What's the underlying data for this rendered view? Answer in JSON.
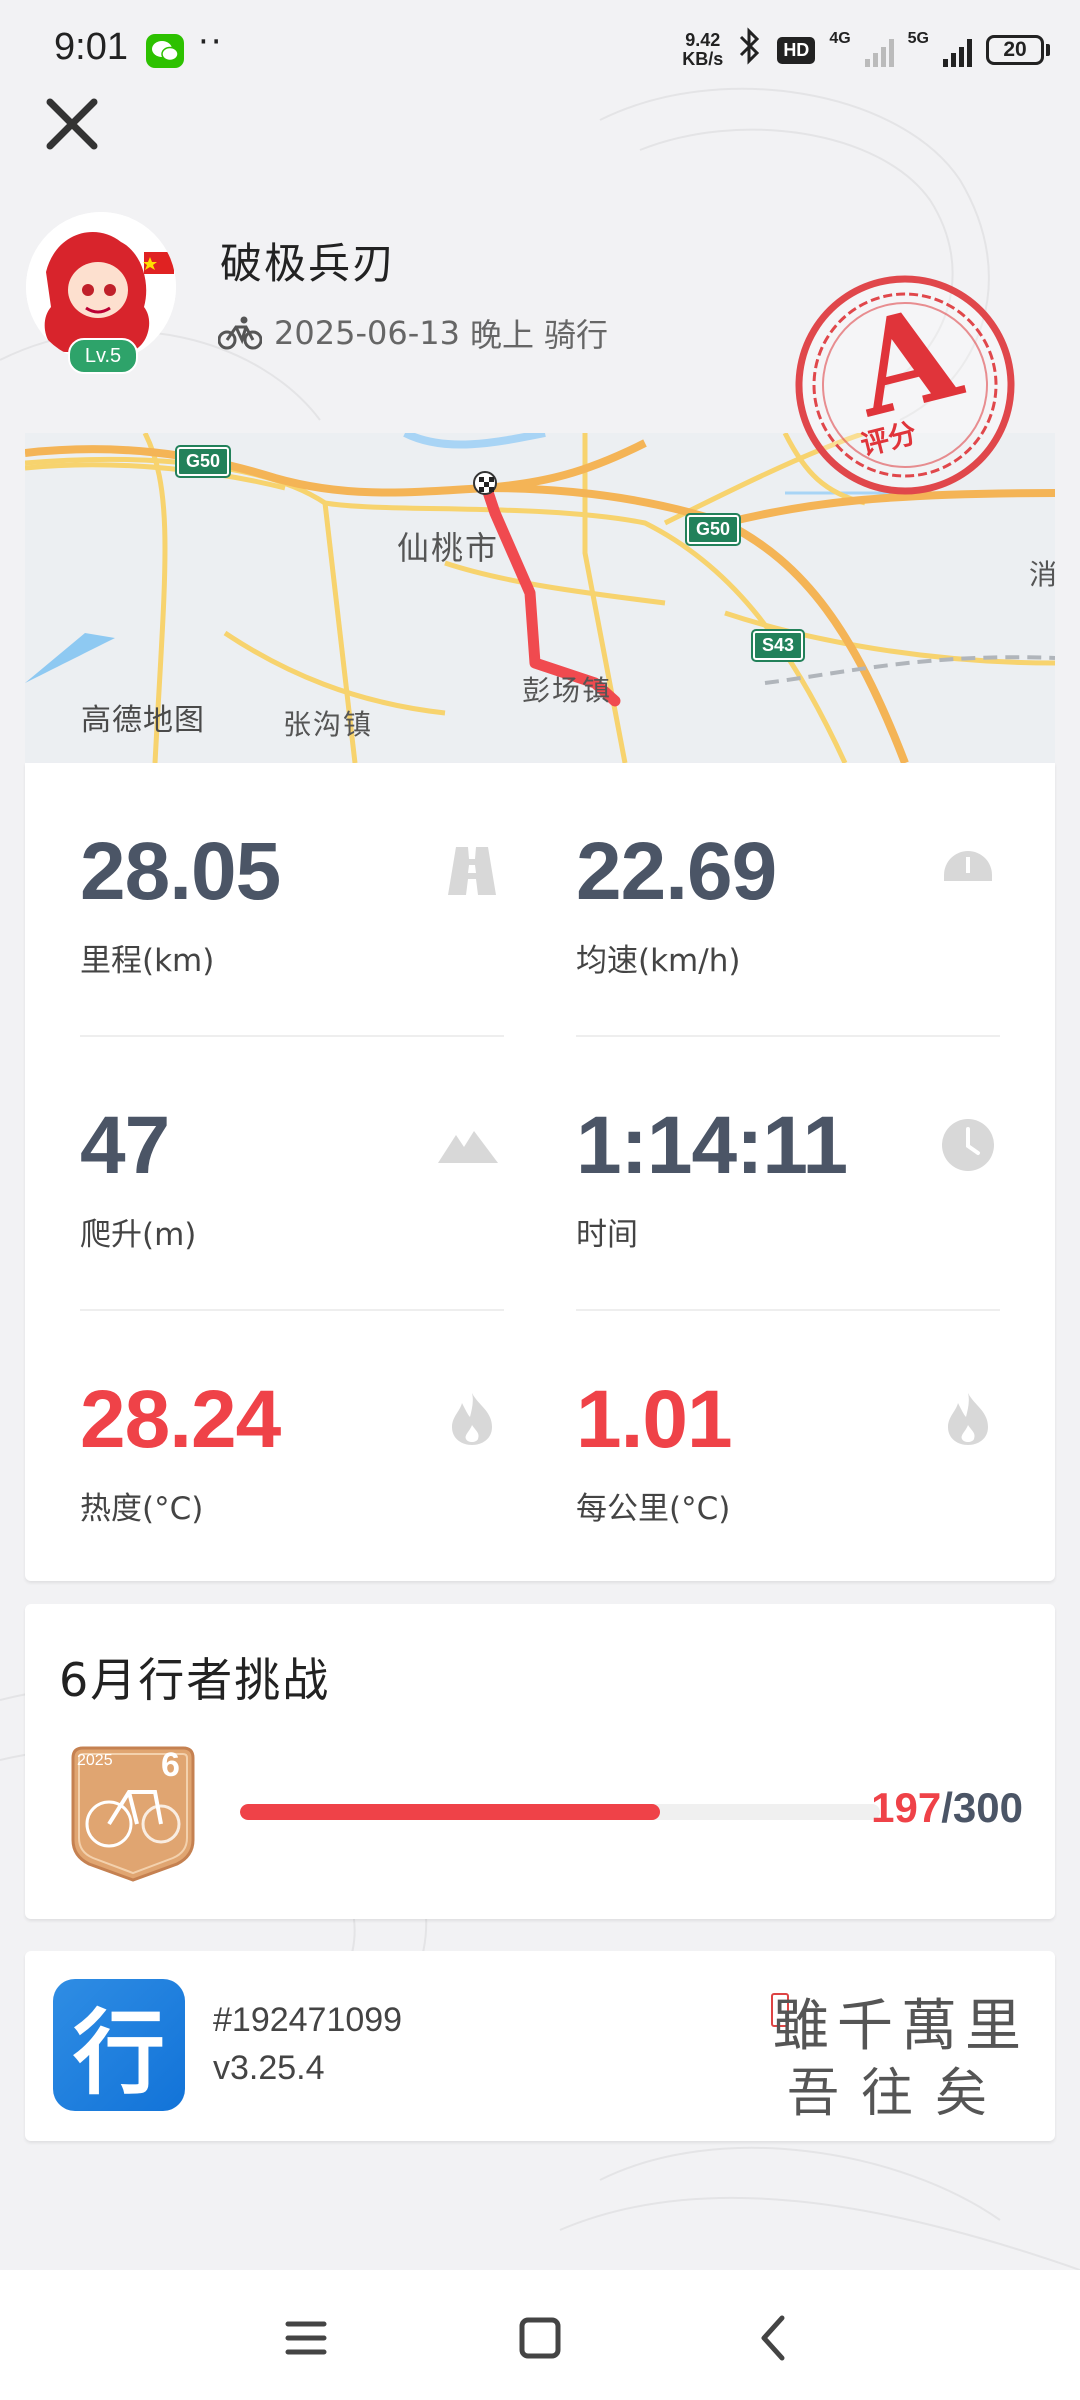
{
  "status_bar": {
    "time": "9:01",
    "dots": "··",
    "net_speed_value": "9.42",
    "net_speed_unit": "KB/s",
    "hd": "HD",
    "net1": "4G",
    "net2": "5G",
    "battery": "20"
  },
  "header": {
    "username": "破极兵刃",
    "level": "Lv.5",
    "date": "2025-06-13",
    "time_of_day": "晚上",
    "activity": "骑行",
    "grade_letter": "A",
    "grade_label": "评分"
  },
  "map": {
    "city": "仙桃市",
    "town1": "张沟镇",
    "town2": "彭场镇",
    "edge": "消",
    "road_sign_1": "G50",
    "road_sign_2": "G50",
    "road_sign_3": "S43",
    "provider": "高德地图"
  },
  "stats": {
    "distance": {
      "value": "28.05",
      "label": "里程(km)"
    },
    "avg_speed": {
      "value": "22.69",
      "label": "均速(km/h)"
    },
    "climb": {
      "value": "47",
      "label": "爬升(m)"
    },
    "duration": {
      "value": "1:14:11",
      "label": "时间"
    },
    "heat": {
      "value": "28.24",
      "label": "热度(°C)"
    },
    "per_km": {
      "value": "1.01",
      "label": "每公里(°C)"
    }
  },
  "challenge": {
    "title": "6月行者挑战",
    "current": "197",
    "separator": "/",
    "target": "300",
    "progress_fraction": 0.657,
    "medal_year": "2025",
    "medal_month": "6"
  },
  "app": {
    "icon_char": "行",
    "id": "#192471099",
    "version": "v3.25.4",
    "motto_line1": "雖千萬里",
    "motto_line2": "吾往矣"
  },
  "colors": {
    "accent_red": "#ef4248",
    "stat_gray": "#4b5566",
    "route_red": "#f04a4f",
    "app_blue": "#1a7fe0"
  }
}
